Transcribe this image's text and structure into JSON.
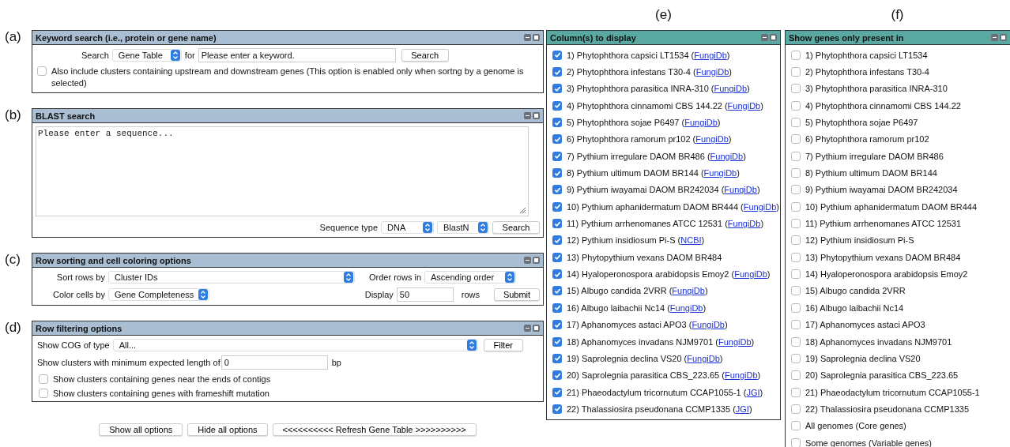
{
  "keyword_search": {
    "label": "(a)",
    "title": "Keyword search (i.e., protein or gene name)",
    "search_label": "Search",
    "scope": "Gene Table",
    "for_label": "for",
    "keyword": {
      "placeholder": "Please enter a keyword."
    },
    "search_button": "Search",
    "include_flanking": {
      "label": "Also include clusters containing upstream and downstream genes (This option is enabled only when sortng by a genome is selected)",
      "checked": false
    }
  },
  "blast_search": {
    "label": "(b)",
    "title": "BLAST search",
    "sequence": {
      "placeholder": "Please enter a sequence..."
    },
    "sequence_type_label": "Sequence type",
    "sequence_type": "DNA",
    "program": "BlastN",
    "search_button": "Search"
  },
  "sorting": {
    "label": "(c)",
    "title": "Row sorting and cell coloring options",
    "sort_label": "Sort rows by",
    "sort_by": "Cluster IDs",
    "order_label": "Order rows in",
    "order": "Ascending order",
    "color_label": "Color cells by",
    "color_by": "Gene Completeness",
    "display_label": "Display",
    "display_value": "50",
    "rows_label": "rows",
    "submit_button": "Submit"
  },
  "filtering": {
    "label": "(d)",
    "title": "Row filtering options",
    "cog_label": "Show COG of type",
    "cog_type": "All...",
    "filter_button": "Filter",
    "min_length_label": "Show clusters with minimum expected length of",
    "min_length": "0",
    "unit": "bp",
    "options": [
      {
        "label": "Show clusters containing genes near the ends of contigs",
        "checked": false
      },
      {
        "label": "Show clusters containing genes with frameshift mutation",
        "checked": false
      }
    ]
  },
  "footer_buttons": [
    "Show all options",
    "Hide all options",
    "<<<<<<<<<< Refresh Gene Table >>>>>>>>>>"
  ],
  "columns_panel": {
    "label": "(e)",
    "title": "Column(s) to display",
    "items": [
      {
        "text": "1) Phytophthora capsici LT1534 (",
        "link": "FungiDb",
        "suffix": ")",
        "checked": true
      },
      {
        "text": "2) Phytophthora infestans T30-4 (",
        "link": "FungiDb",
        "suffix": ")",
        "checked": true
      },
      {
        "text": "3) Phytophthora parasitica INRA-310 (",
        "link": "FungiDb",
        "suffix": ")",
        "checked": true
      },
      {
        "text": "4) Phytophthora cinnamomi CBS 144.22 (",
        "link": "FungiDb",
        "suffix": ")",
        "checked": true
      },
      {
        "text": "5) Phytophthora sojae P6497 (",
        "link": "FungiDb",
        "suffix": ")",
        "checked": true
      },
      {
        "text": "6) Phytophthora ramorum pr102 (",
        "link": "FungiDb",
        "suffix": ")",
        "checked": true
      },
      {
        "text": "7) Pythium irregulare DAOM BR486 (",
        "link": "FungiDb",
        "suffix": ")",
        "checked": true
      },
      {
        "text": "8) Pythium ultimum DAOM BR144 (",
        "link": "FungiDb",
        "suffix": ")",
        "checked": true
      },
      {
        "text": "9) Pythium iwayamai DAOM BR242034 (",
        "link": "FungiDb",
        "suffix": ")",
        "checked": true
      },
      {
        "text": "10) Pythium aphanidermatum DAOM BR444 (",
        "link": "FungiDb",
        "suffix": ")",
        "checked": true
      },
      {
        "text": "11) Pythium arrhenomanes ATCC 12531 (",
        "link": "FungiDb",
        "suffix": ")",
        "checked": true
      },
      {
        "text": "12) Pythium insidiosum Pi-S (",
        "link": "NCBI",
        "suffix": ")",
        "checked": true
      },
      {
        "text": "13) Phytopythium vexans DAOM BR484",
        "checked": true
      },
      {
        "text": "14) Hyaloperonospora arabidopsis Emoy2 (",
        "link": "FungiDb",
        "suffix": ")",
        "checked": true
      },
      {
        "text": "15) Albugo candida 2VRR (",
        "link": "FungiDb",
        "suffix": ")",
        "checked": true
      },
      {
        "text": "16) Albugo laibachii Nc14 (",
        "link": "FungiDb",
        "suffix": ")",
        "checked": true
      },
      {
        "text": "17) Aphanomyces astaci APO3 (",
        "link": "FungiDb",
        "suffix": ")",
        "checked": true
      },
      {
        "text": "18) Aphanomyces invadans NJM9701 (",
        "link": "FungiDb",
        "suffix": ")",
        "checked": true
      },
      {
        "text": "19) Saprolegnia declina VS20 (",
        "link": "FungiDb",
        "suffix": ")",
        "checked": true
      },
      {
        "text": "20) Saprolegnia parasitica CBS_223.65 (",
        "link": "FungiDb",
        "suffix": ")",
        "checked": true
      },
      {
        "text": "21) Phaeodactylum tricornutum CCAP1055-1 (",
        "link": "JGI",
        "suffix": ")",
        "checked": true
      },
      {
        "text": "22) Thalassiosira pseudonana CCMP1335 (",
        "link": "JGI",
        "suffix": ")",
        "checked": true
      }
    ]
  },
  "genes_panel": {
    "label": "(f)",
    "title": "Show genes only present in",
    "items": [
      {
        "text": "1) Phytophthora capsici LT1534",
        "checked": false
      },
      {
        "text": "2) Phytophthora infestans T30-4",
        "checked": false
      },
      {
        "text": "3) Phytophthora parasitica INRA-310",
        "checked": false
      },
      {
        "text": "4) Phytophthora cinnamomi CBS 144.22",
        "checked": false
      },
      {
        "text": "5) Phytophthora sojae P6497",
        "checked": false
      },
      {
        "text": "6) Phytophthora ramorum pr102",
        "checked": false
      },
      {
        "text": "7) Pythium irregulare DAOM BR486",
        "checked": false
      },
      {
        "text": "8) Pythium ultimum DAOM BR144",
        "checked": false
      },
      {
        "text": "9) Pythium iwayamai DAOM BR242034",
        "checked": false
      },
      {
        "text": "10) Pythium aphanidermatum DAOM BR444",
        "checked": false
      },
      {
        "text": "11) Pythium arrhenomanes ATCC 12531",
        "checked": false
      },
      {
        "text": "12) Pythium insidiosum Pi-S",
        "checked": false
      },
      {
        "text": "13) Phytopythium vexans DAOM BR484",
        "checked": false
      },
      {
        "text": "14) Hyaloperonospora arabidopsis Emoy2",
        "checked": false
      },
      {
        "text": "15) Albugo candida 2VRR",
        "checked": false
      },
      {
        "text": "16) Albugo laibachii Nc14",
        "checked": false
      },
      {
        "text": "17) Aphanomyces astaci APO3",
        "checked": false
      },
      {
        "text": "18) Aphanomyces invadans NJM9701",
        "checked": false
      },
      {
        "text": "19) Saprolegnia declina VS20",
        "checked": false
      },
      {
        "text": "20) Saprolegnia parasitica CBS_223.65",
        "checked": false
      },
      {
        "text": "21) Phaeodactylum tricornutum CCAP1055-1",
        "checked": false
      },
      {
        "text": "22) Thalassiosira pseudonana CCMP1335",
        "checked": false
      },
      {
        "text": "All genomes (Core genes)",
        "checked": false
      },
      {
        "text": "Some genomes (Variable genes)",
        "checked": false
      }
    ]
  }
}
